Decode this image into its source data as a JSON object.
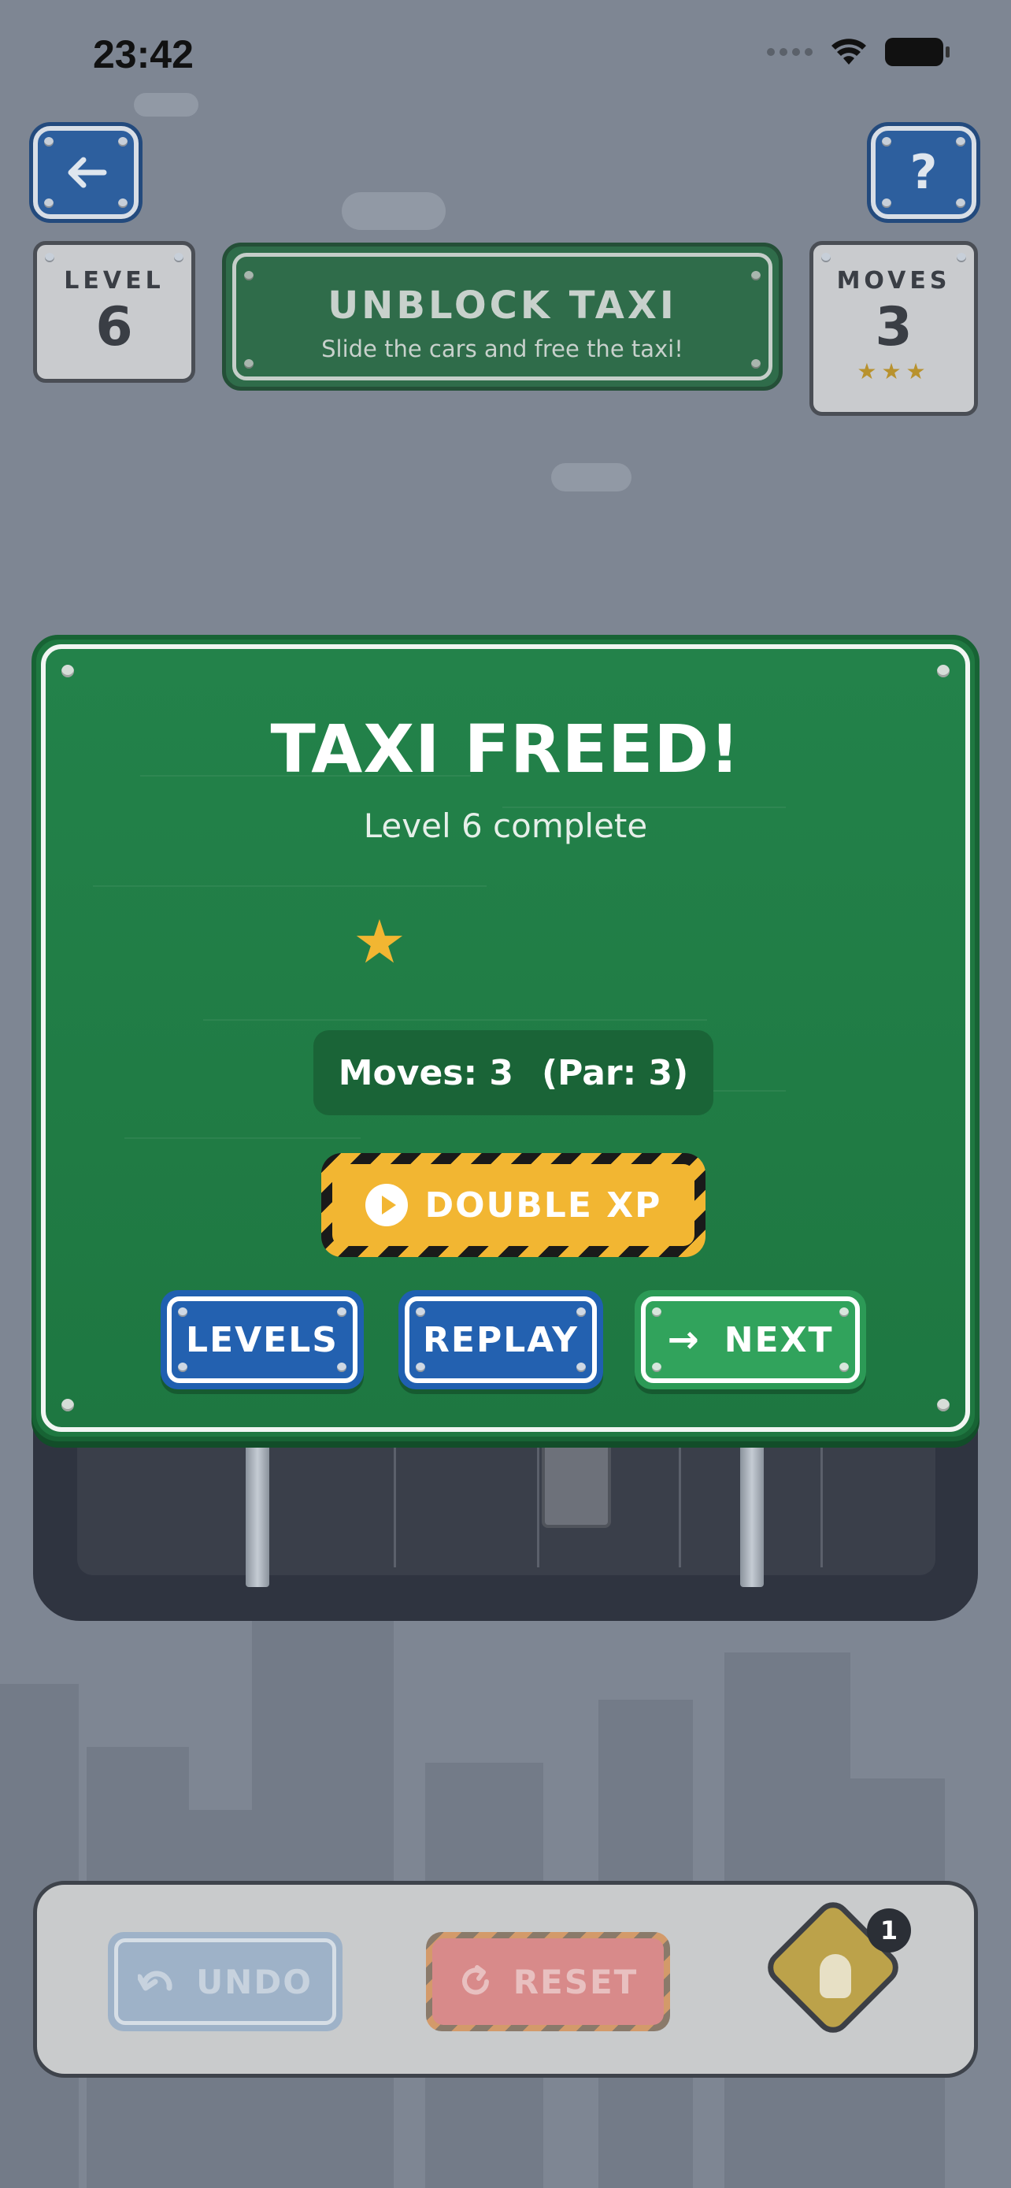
{
  "status_bar": {
    "time": "23:42"
  },
  "header": {
    "back_icon": "arrow-left-icon",
    "help_label": "?",
    "level_label": "LEVEL",
    "level_value": "6",
    "title": "UNBLOCK TAXI",
    "subtitle": "Slide the cars and free the taxi!",
    "moves_label": "MOVES",
    "moves_value": "3",
    "moves_stars": "★★★"
  },
  "modal": {
    "title": "TAXI FREED!",
    "subtitle": "Level 6 complete",
    "stars_earned": 1,
    "moves_text": "Moves: 3",
    "par_text": "(Par: 3)",
    "double_xp_label": "DOUBLE XP",
    "levels_label": "LEVELS",
    "replay_label": "REPLAY",
    "next_label": "NEXT",
    "next_icon": "→"
  },
  "toolbar": {
    "undo_label": "UNDO",
    "reset_label": "RESET",
    "hint_count": "1"
  },
  "colors": {
    "modal_green": "#1f7841",
    "button_blue": "#2361b0",
    "button_green": "#31a35c",
    "star_gold": "#f2b632"
  }
}
